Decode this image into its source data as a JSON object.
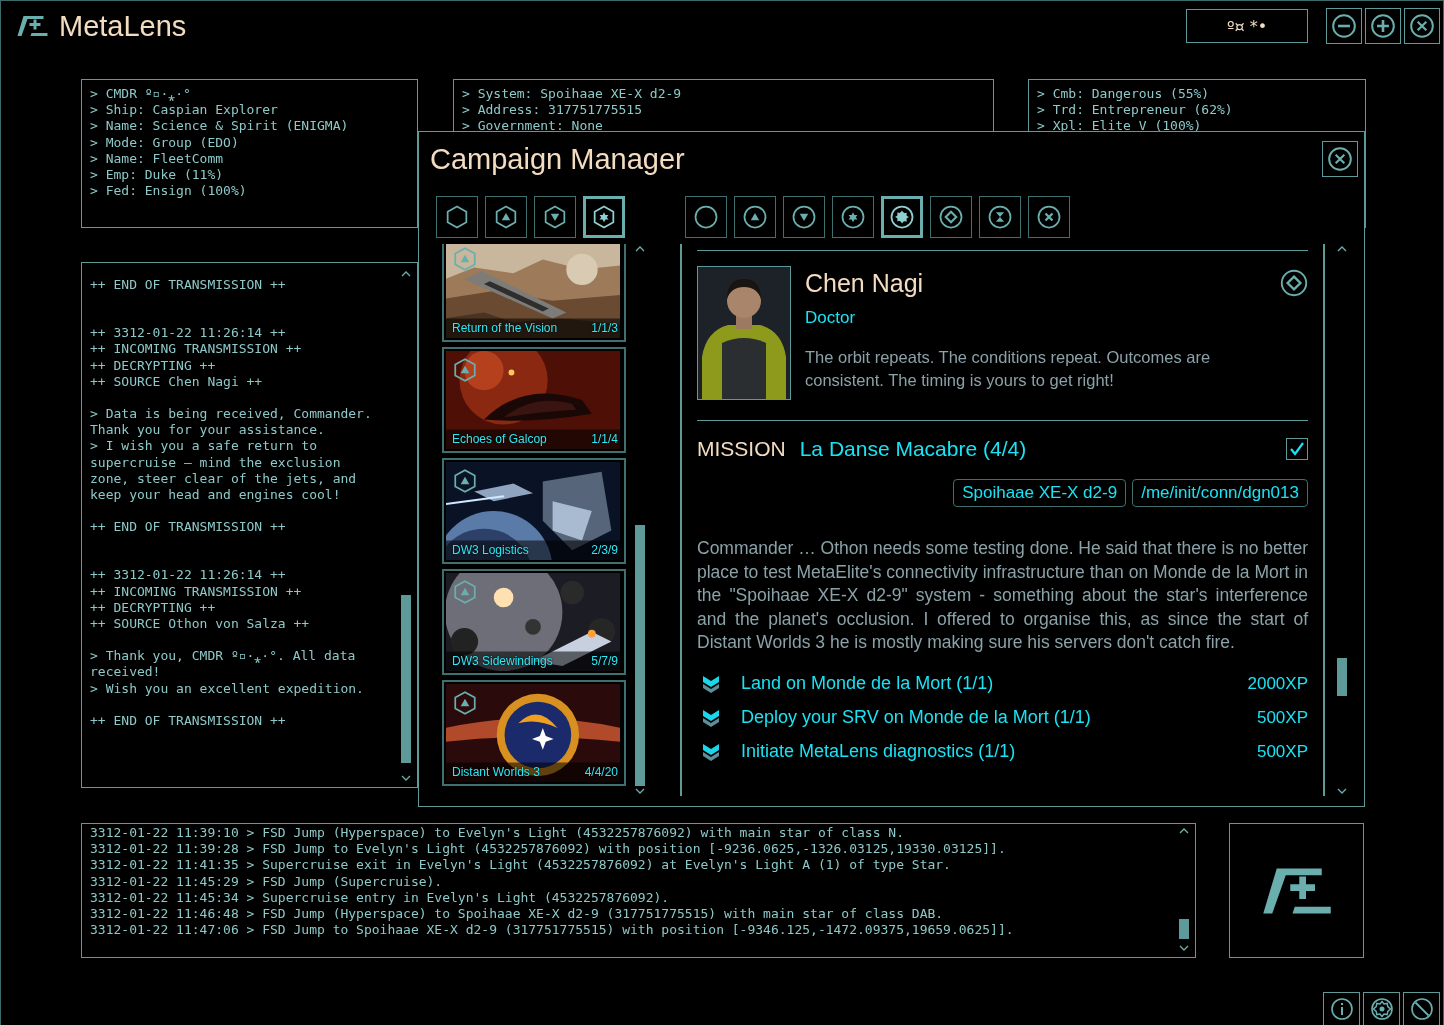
{
  "app": {
    "title": "MetaLens",
    "status": "º¤ *•"
  },
  "commander_panel": {
    "lines": [
      "> CMDR º▫·⁎·°",
      "> Ship: Caspian Explorer",
      "> Name: Science & Spirit (ENIGMA)",
      "> Mode: Group (EDO)",
      "> Name: FleetComm",
      "> Emp: Duke (11%)",
      "> Fed: Ensign (100%)"
    ]
  },
  "system_panel": {
    "lines": [
      "> System: Spoihaae XE-X d2-9",
      "> Address: 317751775515",
      "> Government: None"
    ]
  },
  "ranks_panel": {
    "lines": [
      "> Cmb: Dangerous (55%)",
      "> Trd: Entrepreneur (62%)",
      "> Xpl: Elite V (100%)"
    ]
  },
  "transmission_log": {
    "groups": [
      {
        "kind": "trailer",
        "lines": [
          "++ END OF TRANSMISSION ++"
        ]
      },
      {
        "kind": "header",
        "lines": [
          "++ 3312-01-22 11:26:14 ++",
          "++ INCOMING TRANSMISSION ++",
          "++ DECRYPTING ++",
          "++ SOURCE Chen Nagi ++"
        ]
      },
      {
        "kind": "body",
        "lines": [
          "> Data is being received, Commander. Thank you for your assistance.",
          "> I wish you a safe return to supercruise – mind the exclusion zone, steer clear of the jets, and keep your head and engines cool!"
        ]
      },
      {
        "kind": "trailer",
        "lines": [
          "++ END OF TRANSMISSION ++"
        ]
      },
      {
        "kind": "header",
        "lines": [
          "++ 3312-01-22 11:26:14 ++",
          "++ INCOMING TRANSMISSION ++",
          "++ DECRYPTING ++",
          "++ SOURCE Othon von Salza ++"
        ]
      },
      {
        "kind": "body",
        "lines": [
          "> Thank you, CMDR º▫·⁎·°. All data received!",
          "> Wish you an excellent expedition."
        ]
      },
      {
        "kind": "trailer",
        "lines": [
          "++ END OF TRANSMISSION ++"
        ]
      }
    ]
  },
  "event_log": {
    "lines": [
      "3312-01-22 11:39:10 > FSD Jump (Hyperspace) to Evelyn's Light (4532257876092) with main star of class N.",
      "3312-01-22 11:39:28 > FSD Jump to Evelyn's Light (4532257876092) with position [-9236.0625,-1326.03125,19330.03125]].",
      "3312-01-22 11:41:35 > Supercruise exit in Evelyn's Light (4532257876092) at Evelyn's Light A (1) of type Star.",
      "3312-01-22 11:45:29 > FSD Jump (Supercruise).",
      "3312-01-22 11:45:34 > Supercruise entry in Evelyn's Light (4532257876092).",
      "3312-01-22 11:46:48 > FSD Jump (Hyperspace) to Spoihaae XE-X d2-9 (317751775515) with main star of class DAB.",
      "3312-01-22 11:47:06 > FSD Jump to Spoihaae XE-X d2-9 (317751775515) with position [-9346.125,-1472.09375,19659.0625]]."
    ]
  },
  "campaign_manager": {
    "title": "Campaign Manager",
    "campaign_filters": [
      {
        "kind": "hexagon",
        "selected": false
      },
      {
        "kind": "hex-up",
        "selected": false
      },
      {
        "kind": "hex-down",
        "selected": false
      },
      {
        "kind": "hex-star",
        "selected": true
      }
    ],
    "mission_filters": [
      {
        "kind": "circle",
        "selected": false
      },
      {
        "kind": "circle-up",
        "selected": false
      },
      {
        "kind": "circle-down",
        "selected": false
      },
      {
        "kind": "circle-star",
        "selected": false
      },
      {
        "kind": "circle-gear",
        "selected": true
      },
      {
        "kind": "circle-diamond",
        "selected": false
      },
      {
        "kind": "circle-hourglass",
        "selected": false
      },
      {
        "kind": "circle-x",
        "selected": false
      }
    ],
    "campaigns": [
      {
        "title": "Return of the Vision",
        "counts": "1/1/3"
      },
      {
        "title": "Echoes of Galcop",
        "counts": "1/1/4"
      },
      {
        "title": "DW3 Logistics",
        "counts": "2/3/9"
      },
      {
        "title": "DW3 Sidewindings",
        "counts": "5/7/9"
      },
      {
        "title": "Distant Worlds 3",
        "counts": "4/4/20"
      }
    ],
    "contact": {
      "name": "Chen Nagi",
      "role": "Doctor",
      "quote": "The orbit repeats. The conditions repeat. Outcomes are consistent. The timing is yours to get right!"
    },
    "mission": {
      "label": "MISSION",
      "title": "La Danse Macabre (4/4)",
      "completed": true,
      "tags": [
        "Spoihaae XE-X d2-9",
        "/me/init/conn/dgn013"
      ],
      "description": "Commander … Othon needs some testing done. He said that there is no better place to test MetaElite's connectivity infrastructure than on Monde de la Mort in the \"Spoihaae XE-X d2-9\" system - something about the star's interference and the planet's occlusion. I offered to organise this, as since the start of Distant Worlds 3 he is mostly making sure his servers don't catch fire.",
      "objectives": [
        {
          "text": "Land on Monde de la Mort (1/1)",
          "xp": "2000XP"
        },
        {
          "text": "Deploy your SRV on Monde de la Mort (1/1)",
          "xp": "500XP"
        },
        {
          "text": "Initiate MetaLens diagnostics (1/1)",
          "xp": "500XP"
        }
      ]
    }
  }
}
